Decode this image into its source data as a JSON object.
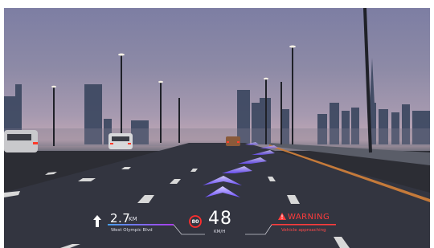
{
  "navigation": {
    "distance_value": "2.7",
    "distance_unit": "KM",
    "street_name": "West Olympic Blvd",
    "direction_icon": "straight-arrow-icon"
  },
  "speed": {
    "limit": "80",
    "value": "48",
    "unit": "KM/H"
  },
  "alert": {
    "title": "WARNING",
    "subtitle": "Vehicle approaching",
    "icon": "warning-triangle-icon",
    "color": "#ff3c3c"
  },
  "colors": {
    "route_chevrons": "#7a5cff",
    "route_bar_start": "#4aa6ff",
    "route_bar_end": "#b23cff",
    "limit_ring": "#ff2d2d"
  }
}
